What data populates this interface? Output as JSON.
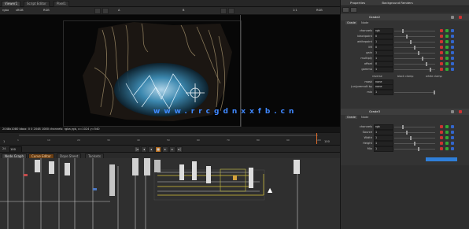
{
  "window": {
    "tabs": [
      "Viewer1",
      "Script Editor",
      "Pixel1"
    ]
  },
  "viewer_toolbar": {
    "channels": "rgba",
    "colorspace": "sRGB",
    "view_mode": "RGB",
    "buffer_a": "A",
    "buffer_b": "B",
    "gain_label": "f/8",
    "gain_value": "1",
    "gamma_label": "y",
    "gamma_value": "1",
    "zoom": "1:1",
    "mode_right": "RGB"
  },
  "viewer": {
    "status_text": "2048x1080 bbox: 0 0 2048 1080 channels: rgba,rgb, x=1024 y=540",
    "watermark": "www.rrcgdnxxfb.cn"
  },
  "timeline": {
    "start": "1",
    "end": "100",
    "current": "100",
    "ticks": [
      "1",
      "10",
      "20",
      "30",
      "40",
      "50",
      "60",
      "70",
      "80",
      "90",
      "100"
    ],
    "fps_label": "24",
    "frame_field": "100"
  },
  "nodegraph_tabs": [
    "Node Graph",
    "Curve Editor",
    "Dope Sheet",
    "Toolsets"
  ],
  "properties": {
    "panel_title": "Properties",
    "panel_tab2": "Background Renders",
    "node1": {
      "name": "Grade2",
      "tabs": [
        "Grade",
        "Node"
      ],
      "rows": [
        {
          "label": "channels",
          "value": "rgb"
        },
        {
          "label": "blackpoint",
          "value": "0"
        },
        {
          "label": "whitepoint",
          "value": "1"
        },
        {
          "label": "lift",
          "value": "0"
        },
        {
          "label": "gain",
          "value": "1"
        },
        {
          "label": "multiply",
          "value": "1"
        },
        {
          "label": "offset",
          "value": "0"
        },
        {
          "label": "gamma",
          "value": "1"
        }
      ],
      "checks": [
        "reverse",
        "black clamp",
        "white clamp"
      ],
      "mask_label": "mask",
      "mask_value": "none",
      "unpremult_label": "(un)premult by",
      "unpremult_value": "none",
      "mix_label": "mix",
      "mix_value": "1"
    },
    "node2": {
      "name": "Grade3",
      "tabs": [
        "Grade",
        "Node"
      ],
      "rows": [
        {
          "label": "channels",
          "value": "rgb"
        },
        {
          "label": "Source",
          "value": "1"
        },
        {
          "label": "Width",
          "value": "1"
        },
        {
          "label": "Height",
          "value": "1"
        },
        {
          "label": "Mix",
          "value": "1"
        }
      ]
    }
  },
  "colors": {
    "accent_blue": "#2f7fd9",
    "viewer_bg": "#070707",
    "nodegraph_bg": "#2f2f2f",
    "panel_bg": "#333333"
  }
}
